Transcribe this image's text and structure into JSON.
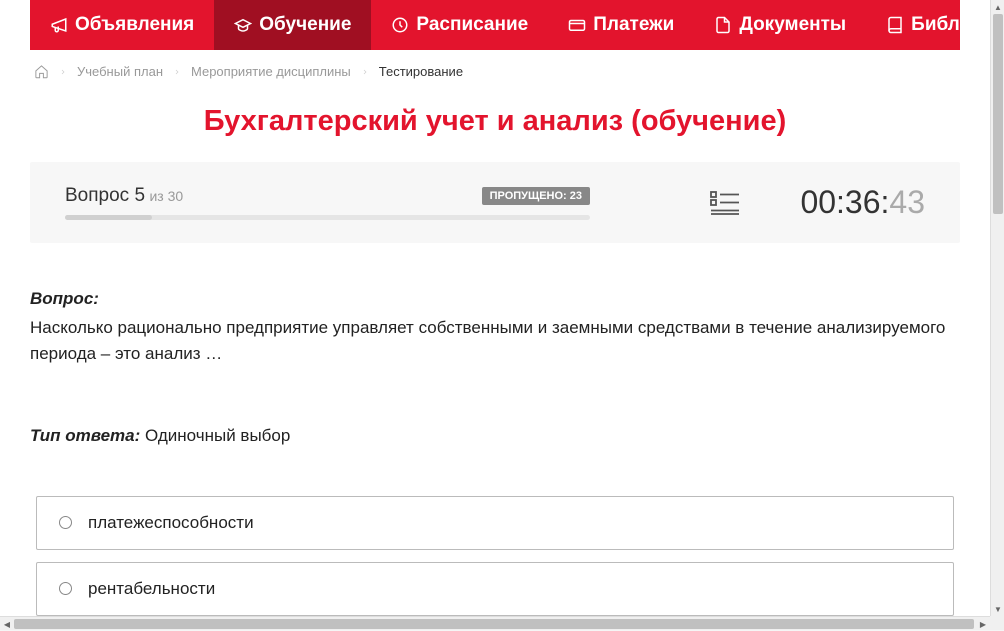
{
  "nav": {
    "items": [
      {
        "label": "Объявления",
        "icon": "megaphone"
      },
      {
        "label": "Обучение",
        "icon": "graduation",
        "active": true
      },
      {
        "label": "Расписание",
        "icon": "clock"
      },
      {
        "label": "Платежи",
        "icon": "card"
      },
      {
        "label": "Документы",
        "icon": "document"
      },
      {
        "label": "Библиотека",
        "icon": "book",
        "dropdown": true
      }
    ]
  },
  "breadcrumb": {
    "items": [
      {
        "label": "Учебный план"
      },
      {
        "label": "Мероприятие дисциплины"
      },
      {
        "label": "Тестирование",
        "current": true
      }
    ]
  },
  "page_title": "Бухгалтерский учет и анализ (обучение)",
  "status": {
    "question_label": "Вопрос 5",
    "question_total": "из 30",
    "skipped_label": "ПРОПУЩЕНО: 23",
    "timer_main": "00:36:",
    "timer_ms": "43"
  },
  "question": {
    "label": "Вопрос:",
    "text": "Насколько рационально предприятие управляет собственными и заемными средствами в течение анализируемого периода – это анализ …"
  },
  "answer_type": {
    "label": "Тип ответа:",
    "value": "Одиночный выбор"
  },
  "answers": [
    {
      "text": "платежеспособности"
    },
    {
      "text": "рентабельности"
    }
  ]
}
